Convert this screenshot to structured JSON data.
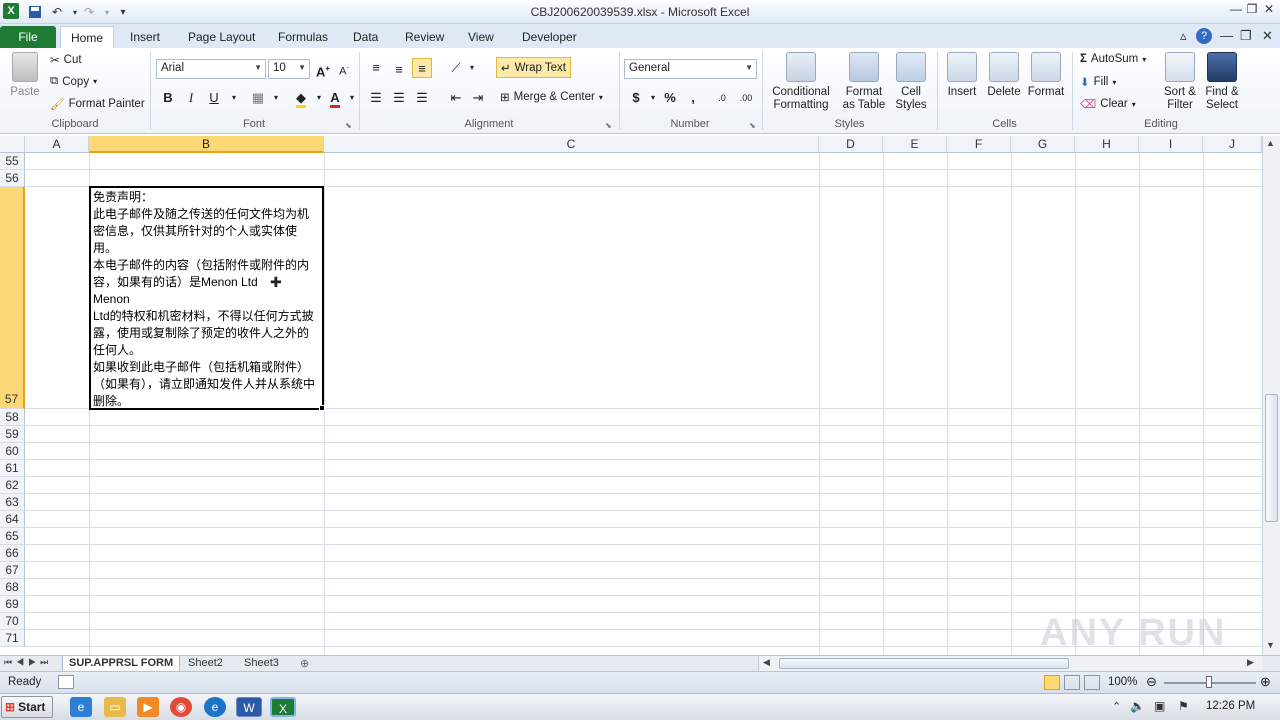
{
  "window": {
    "title": "CBJ200620039539.xlsx  -  Microsoft Excel",
    "controls": {
      "min": "—",
      "max": "❐",
      "close": "✕"
    }
  },
  "ribbon_tabs": [
    "File",
    "Home",
    "Insert",
    "Page Layout",
    "Formulas",
    "Data",
    "Review",
    "View",
    "Developer"
  ],
  "clipboard": {
    "paste": "Paste",
    "cut": "Cut",
    "copy": "Copy",
    "format_painter": "Format Painter",
    "label": "Clipboard"
  },
  "font": {
    "name": "Arial",
    "size": "10",
    "bold": "B",
    "italic": "I",
    "underline": "U",
    "label": "Font"
  },
  "alignment": {
    "wrap": "Wrap Text",
    "merge": "Merge & Center",
    "label": "Alignment"
  },
  "number": {
    "format": "General",
    "currency": "$",
    "percent": "%",
    "comma": ",",
    "label": "Number"
  },
  "styles": {
    "conditional": "Conditional",
    "conditional2": "Formatting",
    "format_as": "Format",
    "format_as2": "as Table",
    "cell": "Cell",
    "cell2": "Styles",
    "label": "Styles"
  },
  "cells": {
    "insert": "Insert",
    "delete": "Delete",
    "format": "Format",
    "label": "Cells"
  },
  "editing": {
    "autosum": "AutoSum",
    "fill": "Fill",
    "clear": "Clear",
    "sort": "Sort &",
    "sort2": "Filter",
    "find": "Find &",
    "find2": "Select",
    "label": "Editing"
  },
  "columns": [
    "A",
    "B",
    "C",
    "D",
    "E",
    "F",
    "G",
    "H",
    "I",
    "J"
  ],
  "rows": [
    "55",
    "56",
    "57",
    "58",
    "59",
    "60",
    "61",
    "62",
    "63",
    "64",
    "65",
    "66",
    "67",
    "68",
    "69",
    "70",
    "71"
  ],
  "cell_b57": [
    "免责声明：",
    "此电子邮件及随之传送的任何文件均为机密信息，仅供其所针对的个人或实体使用。",
    "本电子邮件的内容（包括附件或附件的内容，如果有的话）是Menon Ltd",
    "Menon",
    "Ltd的特权和机密材料，不得以任何方式披露，使用或复制除了预定的收件人之外的任何人。",
    "如果收到此电子邮件（包括机箱或附件）（如果有），请立即通知发件人并从系统中删除。"
  ],
  "sheets": [
    "SUP.APPRSL FORM",
    "Sheet2",
    "Sheet3"
  ],
  "status": {
    "ready": "Ready",
    "zoom": "100%"
  },
  "taskbar": {
    "start": "Start",
    "time": "12:26 PM"
  },
  "watermark": "ANY RUN"
}
